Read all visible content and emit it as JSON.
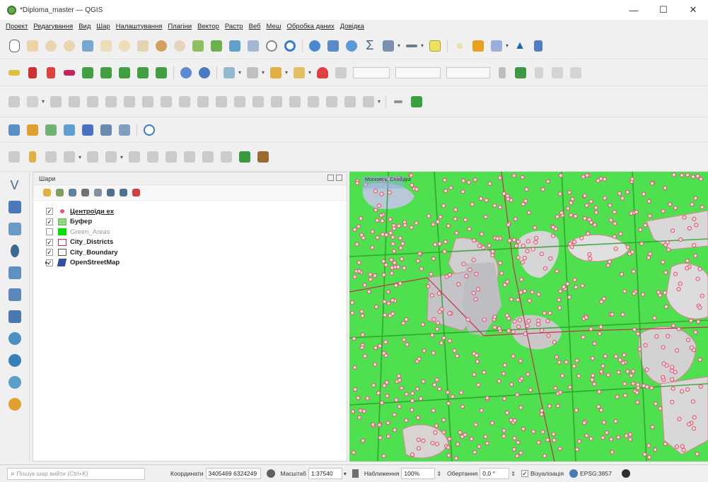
{
  "window": {
    "title": "*Diploma_master — QGIS",
    "controls": {
      "minimize": "—",
      "maximize": "☐",
      "close": "✕"
    }
  },
  "menu": [
    "Проект",
    "Редагування",
    "Вид",
    "Шар",
    "Налаштування",
    "Плагіни",
    "Вектор",
    "Растр",
    "Веб",
    "Меш",
    "Обробка даних",
    "Довідка"
  ],
  "toolbars": {
    "map_navigation": [
      "pan-map",
      "pan-to-selection",
      "zoom-in",
      "zoom-out",
      "zoom-full",
      "zoom-to-selection",
      "zoom-to-layer",
      "zoom-native",
      "zoom-last",
      "zoom-next",
      "new-bookmark",
      "show-bookmarks",
      "temporal-controller",
      "refresh",
      "identify",
      "attribute-table",
      "statistics",
      "sum",
      "measure",
      "annotation",
      "select-features",
      "deselect",
      "map-tips",
      "labels",
      "label-tool"
    ],
    "digitizing": [
      "toggle-edits",
      "save-edits",
      "add-feature",
      "move-feature"
    ],
    "advanced_digitizing": [
      "digitize-with-segment",
      "rotate",
      "simplify"
    ],
    "data_source": [
      "add-vector-layer",
      "add-raster-layer",
      "add-wms"
    ],
    "snapping": [
      "snap-toggle"
    ]
  },
  "layers_panel": {
    "title": "Шари",
    "layers": [
      {
        "name": "Центроїди ex",
        "checked": true,
        "style": "bold-underline",
        "symbol": "point",
        "color": "#e06070"
      },
      {
        "name": "Буфер",
        "checked": true,
        "style": "bold",
        "symbol": "fill",
        "color": "#8fd87c"
      },
      {
        "name": "Green_Areas",
        "checked": false,
        "style": "gray",
        "symbol": "fill",
        "color": "#00e000"
      },
      {
        "name": "City_Districts",
        "checked": true,
        "style": "bold",
        "symbol": "outline",
        "color": "#c0304a"
      },
      {
        "name": "City_Boundary",
        "checked": true,
        "style": "bold",
        "symbol": "outline",
        "color": "#555555"
      },
      {
        "name": "OpenStreetMap",
        "checked": true,
        "style": "bold",
        "symbol": "tiles",
        "color": "#3050a0",
        "expandable": true
      }
    ]
  },
  "map": {
    "place_label": "Московсь. Слобідка",
    "buffer_color": "#4fe04f",
    "point_color": "#e0506a"
  },
  "statusbar": {
    "locator_placeholder": "Пошук шар вийти (Ctrl+K)",
    "coordinate_label": "Координати",
    "coordinate_value": "3405469 6324249",
    "scale_label": "Масштаб",
    "scale_value": "1:37540",
    "magnifier_label": "Наближення",
    "magnifier_value": "100%",
    "rotation_label": "Обертання",
    "rotation_value": "0,0 °",
    "render_label": "Візуалізація",
    "render_checked": true,
    "crs": "EPSG:3857"
  }
}
